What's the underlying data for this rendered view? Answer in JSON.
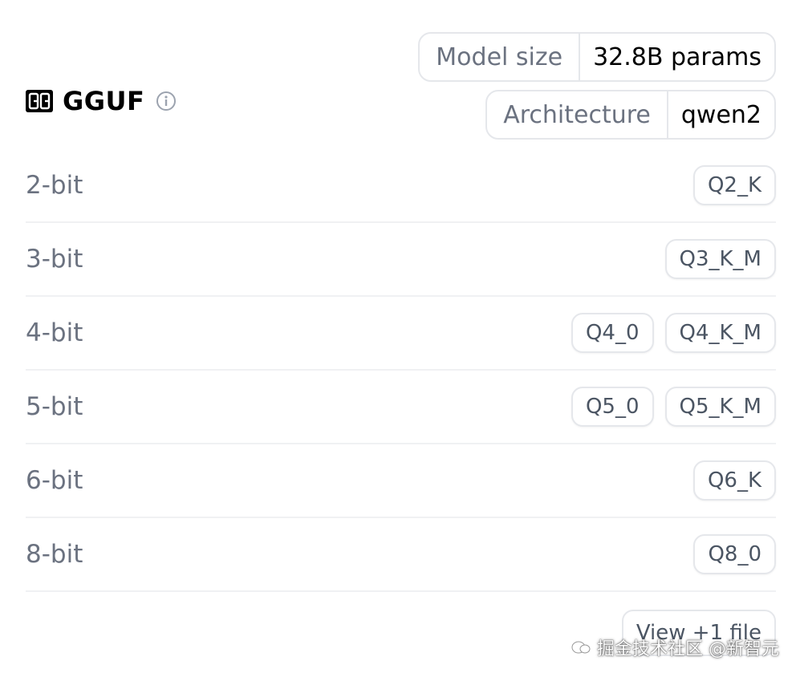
{
  "header": {
    "title": "GGUF",
    "logo_icon": "gguf-logo-icon",
    "info_icon": "info-icon"
  },
  "meta": {
    "model_size": {
      "key": "Model size",
      "value": "32.8B params"
    },
    "architecture": {
      "key": "Architecture",
      "value": "qwen2"
    }
  },
  "rows": [
    {
      "label": "2-bit",
      "tags": [
        "Q2_K"
      ]
    },
    {
      "label": "3-bit",
      "tags": [
        "Q3_K_M"
      ]
    },
    {
      "label": "4-bit",
      "tags": [
        "Q4_0",
        "Q4_K_M"
      ]
    },
    {
      "label": "5-bit",
      "tags": [
        "Q5_0",
        "Q5_K_M"
      ]
    },
    {
      "label": "6-bit",
      "tags": [
        "Q6_K"
      ]
    },
    {
      "label": "8-bit",
      "tags": [
        "Q8_0"
      ]
    }
  ],
  "view_more_label": "View +1 file",
  "watermark": {
    "text": "掘金技术社区 @新智元"
  },
  "colors": {
    "muted_text": "#6b7280",
    "border": "#e5e7eb",
    "divider": "#f0f1f3"
  }
}
